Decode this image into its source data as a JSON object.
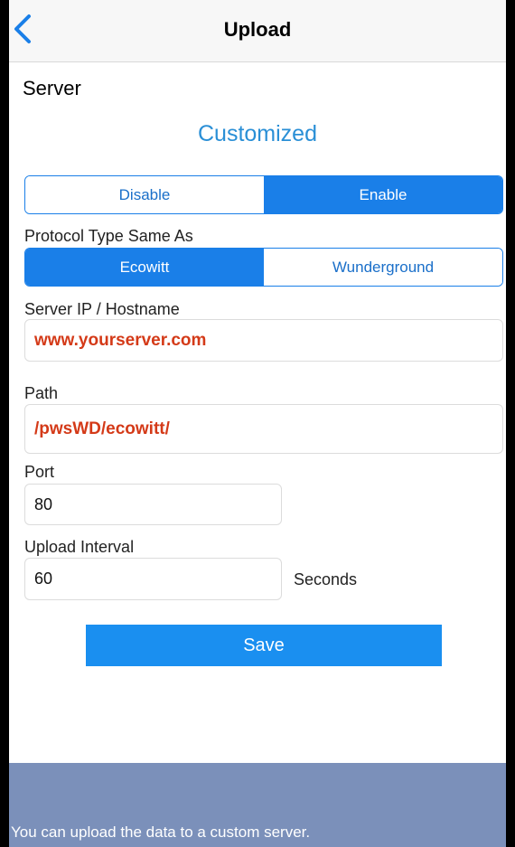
{
  "nav": {
    "title": "Upload"
  },
  "server": {
    "section_label": "Server",
    "title": "Customized",
    "toggle": {
      "disable_label": "Disable",
      "enable_label": "Enable",
      "selected": "Enable"
    }
  },
  "protocol": {
    "label": "Protocol Type Same As",
    "options": [
      "Ecowitt",
      "Wunderground"
    ],
    "selected": "Ecowitt"
  },
  "host": {
    "label": "Server IP / Hostname",
    "value": "www.yourserver.com"
  },
  "path": {
    "label": "Path",
    "value": "/pwsWD/ecowitt/"
  },
  "port": {
    "label": "Port",
    "value": "80"
  },
  "interval": {
    "label": "Upload Interval",
    "value": "60",
    "unit": "Seconds"
  },
  "save_label": "Save",
  "footer_text": "You can upload the data to a custom server.",
  "colors": {
    "accent": "#1a7fe8",
    "title_blue": "#2a8fd6",
    "value_red": "#d43a18",
    "footer_bg": "#7b90ba"
  }
}
